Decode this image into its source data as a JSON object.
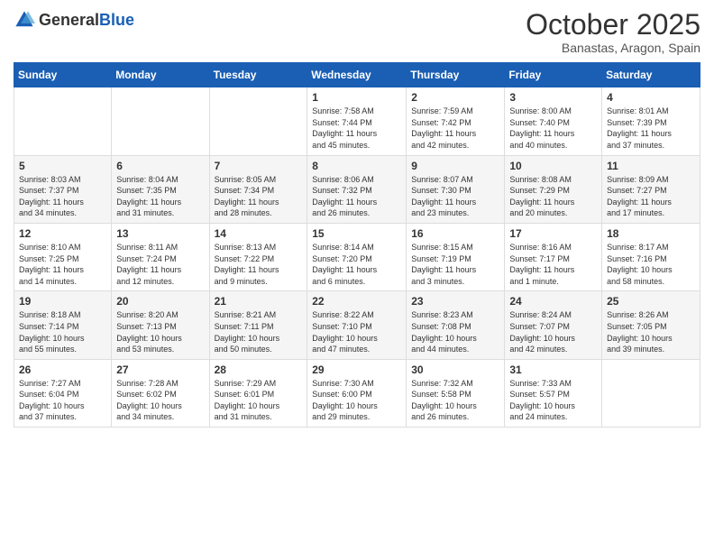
{
  "header": {
    "logo_general": "General",
    "logo_blue": "Blue",
    "month": "October 2025",
    "location": "Banastas, Aragon, Spain"
  },
  "weekdays": [
    "Sunday",
    "Monday",
    "Tuesday",
    "Wednesday",
    "Thursday",
    "Friday",
    "Saturday"
  ],
  "weeks": [
    [
      {
        "day": "",
        "info": ""
      },
      {
        "day": "",
        "info": ""
      },
      {
        "day": "",
        "info": ""
      },
      {
        "day": "1",
        "info": "Sunrise: 7:58 AM\nSunset: 7:44 PM\nDaylight: 11 hours\nand 45 minutes."
      },
      {
        "day": "2",
        "info": "Sunrise: 7:59 AM\nSunset: 7:42 PM\nDaylight: 11 hours\nand 42 minutes."
      },
      {
        "day": "3",
        "info": "Sunrise: 8:00 AM\nSunset: 7:40 PM\nDaylight: 11 hours\nand 40 minutes."
      },
      {
        "day": "4",
        "info": "Sunrise: 8:01 AM\nSunset: 7:39 PM\nDaylight: 11 hours\nand 37 minutes."
      }
    ],
    [
      {
        "day": "5",
        "info": "Sunrise: 8:03 AM\nSunset: 7:37 PM\nDaylight: 11 hours\nand 34 minutes."
      },
      {
        "day": "6",
        "info": "Sunrise: 8:04 AM\nSunset: 7:35 PM\nDaylight: 11 hours\nand 31 minutes."
      },
      {
        "day": "7",
        "info": "Sunrise: 8:05 AM\nSunset: 7:34 PM\nDaylight: 11 hours\nand 28 minutes."
      },
      {
        "day": "8",
        "info": "Sunrise: 8:06 AM\nSunset: 7:32 PM\nDaylight: 11 hours\nand 26 minutes."
      },
      {
        "day": "9",
        "info": "Sunrise: 8:07 AM\nSunset: 7:30 PM\nDaylight: 11 hours\nand 23 minutes."
      },
      {
        "day": "10",
        "info": "Sunrise: 8:08 AM\nSunset: 7:29 PM\nDaylight: 11 hours\nand 20 minutes."
      },
      {
        "day": "11",
        "info": "Sunrise: 8:09 AM\nSunset: 7:27 PM\nDaylight: 11 hours\nand 17 minutes."
      }
    ],
    [
      {
        "day": "12",
        "info": "Sunrise: 8:10 AM\nSunset: 7:25 PM\nDaylight: 11 hours\nand 14 minutes."
      },
      {
        "day": "13",
        "info": "Sunrise: 8:11 AM\nSunset: 7:24 PM\nDaylight: 11 hours\nand 12 minutes."
      },
      {
        "day": "14",
        "info": "Sunrise: 8:13 AM\nSunset: 7:22 PM\nDaylight: 11 hours\nand 9 minutes."
      },
      {
        "day": "15",
        "info": "Sunrise: 8:14 AM\nSunset: 7:20 PM\nDaylight: 11 hours\nand 6 minutes."
      },
      {
        "day": "16",
        "info": "Sunrise: 8:15 AM\nSunset: 7:19 PM\nDaylight: 11 hours\nand 3 minutes."
      },
      {
        "day": "17",
        "info": "Sunrise: 8:16 AM\nSunset: 7:17 PM\nDaylight: 11 hours\nand 1 minute."
      },
      {
        "day": "18",
        "info": "Sunrise: 8:17 AM\nSunset: 7:16 PM\nDaylight: 10 hours\nand 58 minutes."
      }
    ],
    [
      {
        "day": "19",
        "info": "Sunrise: 8:18 AM\nSunset: 7:14 PM\nDaylight: 10 hours\nand 55 minutes."
      },
      {
        "day": "20",
        "info": "Sunrise: 8:20 AM\nSunset: 7:13 PM\nDaylight: 10 hours\nand 53 minutes."
      },
      {
        "day": "21",
        "info": "Sunrise: 8:21 AM\nSunset: 7:11 PM\nDaylight: 10 hours\nand 50 minutes."
      },
      {
        "day": "22",
        "info": "Sunrise: 8:22 AM\nSunset: 7:10 PM\nDaylight: 10 hours\nand 47 minutes."
      },
      {
        "day": "23",
        "info": "Sunrise: 8:23 AM\nSunset: 7:08 PM\nDaylight: 10 hours\nand 44 minutes."
      },
      {
        "day": "24",
        "info": "Sunrise: 8:24 AM\nSunset: 7:07 PM\nDaylight: 10 hours\nand 42 minutes."
      },
      {
        "day": "25",
        "info": "Sunrise: 8:26 AM\nSunset: 7:05 PM\nDaylight: 10 hours\nand 39 minutes."
      }
    ],
    [
      {
        "day": "26",
        "info": "Sunrise: 7:27 AM\nSunset: 6:04 PM\nDaylight: 10 hours\nand 37 minutes."
      },
      {
        "day": "27",
        "info": "Sunrise: 7:28 AM\nSunset: 6:02 PM\nDaylight: 10 hours\nand 34 minutes."
      },
      {
        "day": "28",
        "info": "Sunrise: 7:29 AM\nSunset: 6:01 PM\nDaylight: 10 hours\nand 31 minutes."
      },
      {
        "day": "29",
        "info": "Sunrise: 7:30 AM\nSunset: 6:00 PM\nDaylight: 10 hours\nand 29 minutes."
      },
      {
        "day": "30",
        "info": "Sunrise: 7:32 AM\nSunset: 5:58 PM\nDaylight: 10 hours\nand 26 minutes."
      },
      {
        "day": "31",
        "info": "Sunrise: 7:33 AM\nSunset: 5:57 PM\nDaylight: 10 hours\nand 24 minutes."
      },
      {
        "day": "",
        "info": ""
      }
    ]
  ]
}
